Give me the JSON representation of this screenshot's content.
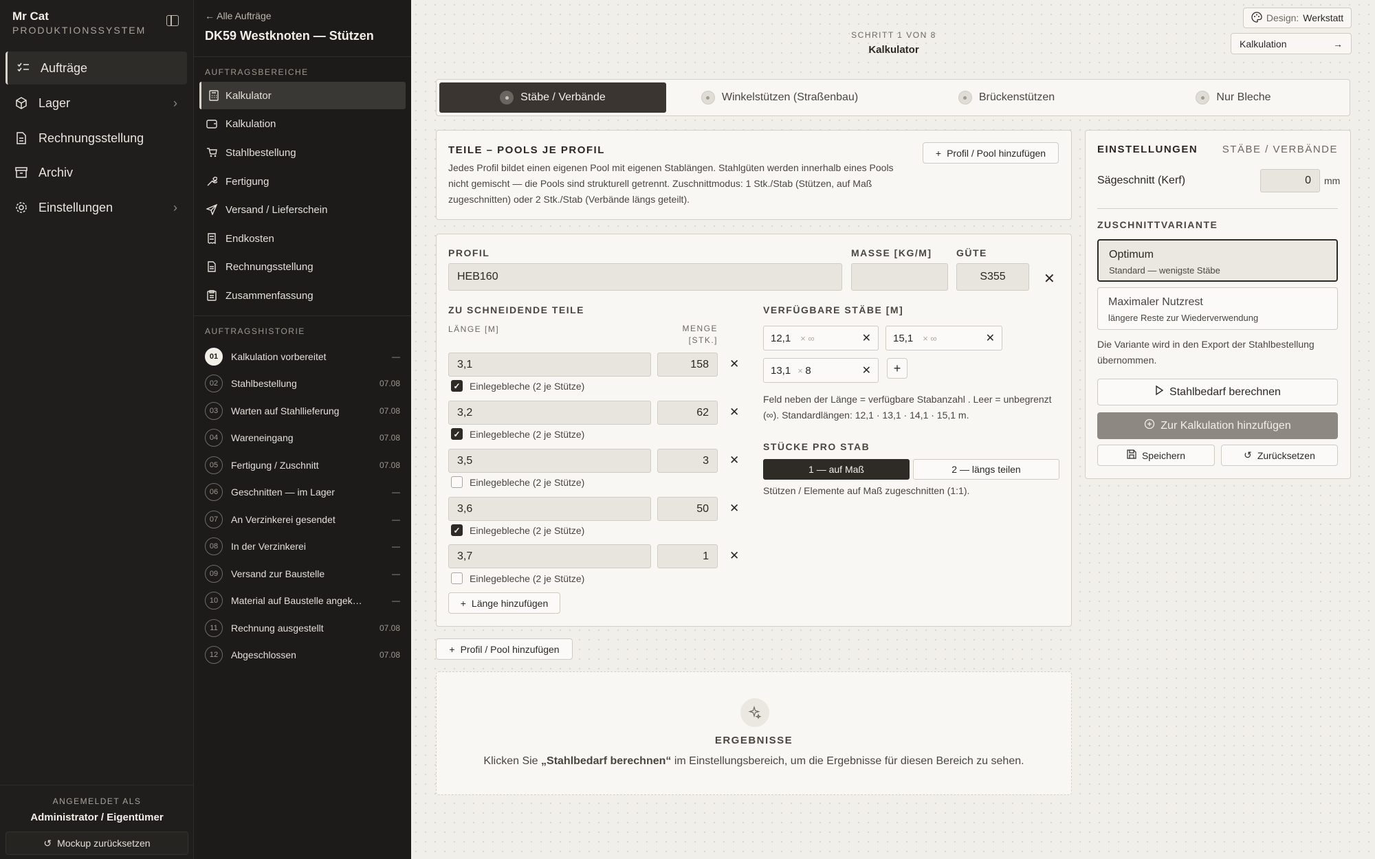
{
  "brand": {
    "name": "Mr Cat",
    "sub": "PRODUKTIONSSYSTEM"
  },
  "nav": [
    {
      "label": "Aufträge"
    },
    {
      "label": "Lager"
    },
    {
      "label": "Rechnungsstellung"
    },
    {
      "label": "Archiv"
    },
    {
      "label": "Einstellungen"
    }
  ],
  "footer": {
    "signed_in_as": "ANGEMELDET ALS",
    "user": "Administrator / Eigentümer",
    "reset": "Mockup zurücksetzen"
  },
  "order": {
    "back": "Alle Aufträge",
    "title": "DK59 Westknoten — Stützen"
  },
  "areas": {
    "heading": "AUFTRAGSBEREICHE",
    "items": [
      {
        "label": "Kalkulator"
      },
      {
        "label": "Kalkulation"
      },
      {
        "label": "Stahlbestellung"
      },
      {
        "label": "Fertigung"
      },
      {
        "label": "Versand / Lieferschein"
      },
      {
        "label": "Endkosten"
      },
      {
        "label": "Rechnungsstellung"
      },
      {
        "label": "Zusammenfassung"
      }
    ]
  },
  "history": {
    "heading": "AUFTRAGSHISTORIE",
    "items": [
      {
        "num": "01",
        "label": "Kalkulation vorbereitet",
        "date": "—"
      },
      {
        "num": "02",
        "label": "Stahlbestellung",
        "date": "07.08"
      },
      {
        "num": "03",
        "label": "Warten auf Stahllieferung",
        "date": "07.08"
      },
      {
        "num": "04",
        "label": "Wareneingang",
        "date": "07.08"
      },
      {
        "num": "05",
        "label": "Fertigung / Zuschnitt",
        "date": "07.08"
      },
      {
        "num": "06",
        "label": "Geschnitten — im Lager",
        "date": "—"
      },
      {
        "num": "07",
        "label": "An Verzinkerei gesendet",
        "date": "—"
      },
      {
        "num": "08",
        "label": "In der Verzinkerei",
        "date": "—"
      },
      {
        "num": "09",
        "label": "Versand zur Baustelle",
        "date": "—"
      },
      {
        "num": "10",
        "label": "Material auf Baustelle angekommen",
        "date": "—"
      },
      {
        "num": "11",
        "label": "Rechnung ausgestellt",
        "date": "07.08"
      },
      {
        "num": "12",
        "label": "Abgeschlossen",
        "date": "07.08"
      }
    ]
  },
  "step": {
    "label": "SCHRITT 1 VON 8",
    "title": "Kalkulator"
  },
  "design": {
    "key": "Design:",
    "value": "Werkstatt"
  },
  "next_button": "Kalkulation",
  "tabs": [
    {
      "label": "Stäbe / Verbände"
    },
    {
      "label": "Winkelstützen (Straßenbau)"
    },
    {
      "label": "Brückenstützen"
    },
    {
      "label": "Nur Bleche"
    }
  ],
  "pools": {
    "title": "TEILE – POOLS JE PROFIL",
    "add": "Profil / Pool hinzufügen",
    "desc": "Jedes Profil bildet einen eigenen Pool mit eigenen Stablängen. Stahlgüten werden innerhalb eines Pools nicht gemischt — die Pools sind strukturell getrennt. Zuschnittmodus: 1 Stk./Stab (Stützen, auf Maß zugeschnitten) oder 2 Stk./Stab (Verbände längs geteilt)."
  },
  "pool": {
    "profile_label": "PROFIL",
    "profile": "HEB160",
    "mass_label": "MASSE [KG/M]",
    "mass": "",
    "grade_label": "GÜTE",
    "grade": "S355",
    "parts_label": "ZU SCHNEIDENDE TEILE",
    "len_col": "LÄNGE [M]",
    "qty_col1": "MENGE",
    "qty_col2": "[STK.]",
    "parts": [
      {
        "length": "3,1",
        "qty": "158",
        "plates": true,
        "plates_label": "Einlegebleche (2 je Stütze)"
      },
      {
        "length": "3,2",
        "qty": "62",
        "plates": true,
        "plates_label": "Einlegebleche (2 je Stütze)"
      },
      {
        "length": "3,5",
        "qty": "3",
        "plates": false,
        "plates_label": "Einlegebleche (2 je Stütze)"
      },
      {
        "length": "3,6",
        "qty": "50",
        "plates": true,
        "plates_label": "Einlegebleche (2 je Stütze)"
      },
      {
        "length": "3,7",
        "qty": "1",
        "plates": false,
        "plates_label": "Einlegebleche (2 je Stütze)"
      }
    ],
    "add_length": "Länge hinzufügen",
    "bars_label": "VERFÜGBARE STÄBE [M]",
    "bars": [
      {
        "length": "12,1",
        "count": "∞"
      },
      {
        "length": "15,1",
        "count": "∞"
      },
      {
        "length": "13,1",
        "count": "8"
      }
    ],
    "bars_hint": "Feld neben der Länge = verfügbare Stabanzahl . Leer = unbegrenzt (∞). Standardlängen: 12,1 · 13,1 · 14,1 · 15,1 m.",
    "per_bar_label": "STÜCKE PRO STAB",
    "per_bar_opts": [
      "1 — auf Maß",
      "2 — längs teilen"
    ],
    "per_bar_hint": "Stützen / Elemente auf Maß zugeschnitten (1:1)."
  },
  "add_pool": "Profil / Pool hinzufügen",
  "results": {
    "title": "ERGEBNISSE",
    "pre": "Klicken Sie ",
    "bold": "„Stahlbedarf berechnen“",
    "post": " im Einstellungsbereich, um die Ergebnisse für diesen Bereich zu sehen."
  },
  "settings": {
    "title": "EINSTELLUNGEN",
    "scope": "STÄBE / VERBÄNDE",
    "kerf_label": "Sägeschnitt (Kerf)",
    "kerf": "0",
    "kerf_unit": "mm",
    "variant_label": "ZUSCHNITTVARIANTE",
    "variants": [
      {
        "title": "Optimum",
        "sub": "Standard — wenigste Stäbe"
      },
      {
        "title": "Maximaler Nutzrest",
        "sub": "längere Reste zur Wiederverwendung"
      }
    ],
    "note": "Die Variante wird in den Export der Stahlbestellung übernommen.",
    "calc": "Stahlbedarf berechnen",
    "add": "Zur Kalkulation hinzufügen",
    "save": "Speichern",
    "reset": "Zurücksetzen"
  }
}
